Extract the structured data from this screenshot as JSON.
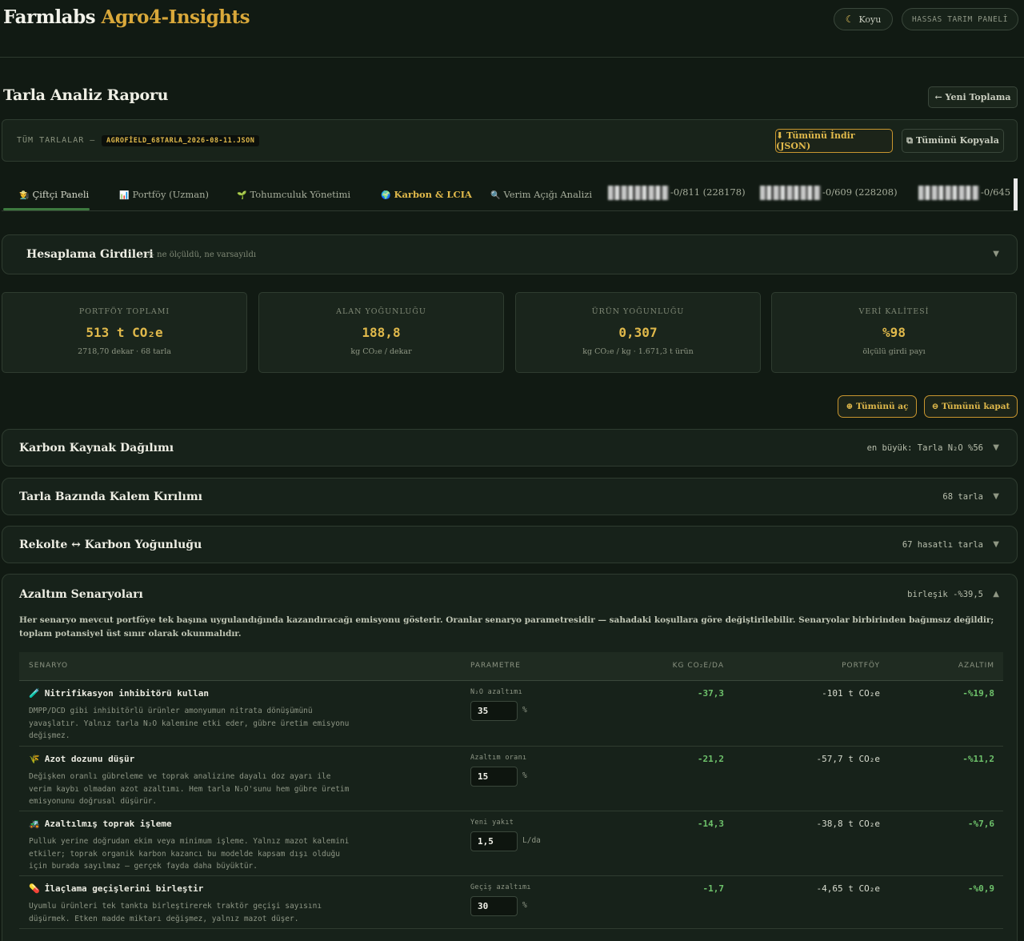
{
  "header": {
    "brand_main": "Farmlabs",
    "brand_accent": "Agro4-Insights",
    "theme_icon": "moon-icon",
    "theme_label": "Koyu",
    "panel_label": "HASSAS TARIM PANELİ"
  },
  "page": {
    "title": "Tarla Analiz Raporu",
    "new_button": "← Yeni Toplama"
  },
  "files": {
    "label": "TÜM TARLALAR —",
    "filename": "AGROFİELD_68TARLA_2026-08-11.JSON",
    "download_button": "⬇ Tümünü İndir (JSON)",
    "copy_button": "⧉ Tümünü Kopyala"
  },
  "tabs": [
    {
      "icon": "👨‍🌾",
      "label": "Çiftçi Paneli"
    },
    {
      "icon": "📊",
      "label": "Portföy (Uzman)"
    },
    {
      "icon": "🌱",
      "label": "Tohumculuk Yönetimi"
    },
    {
      "icon": "🌍",
      "label": "Karbon & LCIA"
    },
    {
      "icon": "🔍",
      "label": "Verim Açığı Analizi"
    },
    {
      "label": "-0/811 (228178)"
    },
    {
      "label": "-0/609 (228208)"
    },
    {
      "label": "-0/645"
    }
  ],
  "inputs_panel": {
    "title": "Hesaplama Girdileri",
    "subtitle": "— ne ölçüldü, ne varsayıldı"
  },
  "kpis": [
    {
      "label": "PORTFÖY TOPLAMI",
      "value": "513 t CO₂e",
      "sub": "2718,70 dekar · 68 tarla"
    },
    {
      "label": "ALAN YOĞUNLUĞU",
      "value": "188,8",
      "sub": "kg CO₂e / dekar"
    },
    {
      "label": "ÜRÜN YOĞUNLUĞU",
      "value": "0,307",
      "sub": "kg CO₂e / kg · 1.671,3 t ürün"
    },
    {
      "label": "VERİ KALİTESİ",
      "value": "%98",
      "sub": "ölçülü girdi payı"
    }
  ],
  "controls": {
    "expand_all": "⊕ Tümünü aç",
    "collapse_all": "⊖ Tümünü kapat"
  },
  "sections": [
    {
      "title": "Karbon Kaynak Dağılımı",
      "meta": "en büyük: Tarla N₂O %56"
    },
    {
      "title": "Tarla Bazında Kalem Kırılımı",
      "meta": "68 tarla"
    },
    {
      "title": "Rekolte ↔ Karbon Yoğunluğu",
      "meta": "67 hasatlı tarla"
    }
  ],
  "scenarios": {
    "title": "Azaltım Senaryoları",
    "meta": "birleşik -%39,5",
    "description": "Her senaryo mevcut portföye tek başına uygulandığında kazandıracağı emisyonu gösterir. Oranlar senaryo parametresidir — sahadaki koşullara göre değiştirilebilir. Senaryolar birbirinden bağımsız değildir; toplam potansiyel üst sınır olarak okunmalıdır.",
    "columns": [
      "SENARYO",
      "PARAMETRE",
      "KG CO₂E/DA",
      "PORTFÖY",
      "AZALTIM"
    ],
    "rows": [
      {
        "icon": "🧪",
        "name": "Nitrifikasyon inhibitörü kullan",
        "desc": "DMPP/DCD gibi inhibitörlü ürünler amonyumun nitrata dönüşümünü yavaşlatır. Yalnız tarla N₂O kalemine etki eder, gübre üretim emisyonu değişmez.",
        "param_label": "N₂O azaltımı",
        "param_value": "35",
        "unit": "%",
        "kg": "-37,3",
        "portfolio": "-101 t CO₂e",
        "reduction": "-%19,8"
      },
      {
        "icon": "🌾",
        "name": "Azot dozunu düşür",
        "desc": "Değişken oranlı gübreleme ve toprak analizine dayalı doz ayarı ile verim kaybı olmadan azot azaltımı. Hem tarla N₂O'sunu hem gübre üretim emisyonunu doğrusal düşürür.",
        "param_label": "Azaltım oranı",
        "param_value": "15",
        "unit": "%",
        "kg": "-21,2",
        "portfolio": "-57,7 t CO₂e",
        "reduction": "-%11,2"
      },
      {
        "icon": "🚜",
        "name": "Azaltılmış toprak işleme",
        "desc": "Pulluk yerine doğrudan ekim veya minimum işleme. Yalnız mazot kalemini etkiler; toprak organik karbon kazancı bu modelde kapsam dışı olduğu için burada sayılmaz — gerçek fayda daha büyüktür.",
        "param_label": "Yeni yakıt",
        "param_value": "1,5",
        "unit": "L/da",
        "kg": "-14,3",
        "portfolio": "-38,8 t CO₂e",
        "reduction": "-%7,6"
      },
      {
        "icon": "💊",
        "name": "İlaçlama geçişlerini birleştir",
        "desc": "Uyumlu ürünleri tek tankta birleştirerek traktör geçişi sayısını düşürmek. Etken madde miktarı değişmez, yalnız mazot düşer.",
        "param_label": "Geçiş azaltımı",
        "param_value": "30",
        "unit": "%",
        "kg": "-1,7",
        "portfolio": "-4,65 t CO₂e",
        "reduction": "-%0,9"
      }
    ]
  },
  "colors": {
    "background": "#111a13",
    "accent_gold": "#e0b94b",
    "positive_green": "#6ec26b",
    "tab_underline": "#3d7a3f"
  }
}
